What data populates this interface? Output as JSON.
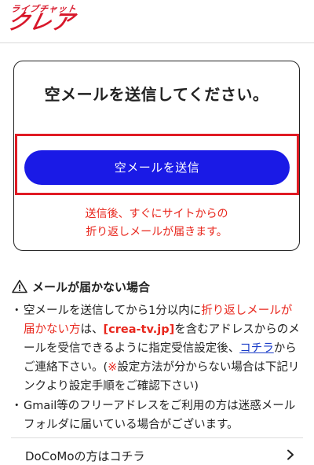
{
  "header": {
    "logo_top": "ライブチャット",
    "logo_main": "クレア"
  },
  "card": {
    "title": "空メールを送信してください。",
    "send_button": "空メールを送信",
    "note_line1": "送信後、すぐにサイトからの",
    "note_line2": "折り返しメールが届きます。"
  },
  "warning": {
    "title": "メールが届かない場合",
    "bullet1": {
      "dot": "・",
      "t1": "空メールを送信してから1分以内に",
      "t2_red": "折り返しメールが届かない方",
      "t3": "は、",
      "t4_red_bold": "[crea-tv.jp]",
      "t5": "を含むアドレスからのメールを受信できるように指定受信設定後、",
      "t6_link": "コチラ",
      "t7": "からご連絡下さい。(",
      "t8_red": "※",
      "t9": "設定方法が分からない場合は下記リンクより設定手順をご確認下さい)"
    },
    "bullet2": {
      "dot": "・",
      "text": "Gmail等のフリーアドレスをご利用の方は迷惑メールフォルダに届いている場合がございます。"
    }
  },
  "links": {
    "docomo": "DoCoMoの方はコチラ"
  },
  "colors": {
    "brand_red": "#d8182b",
    "button_blue": "#1a1ae6",
    "alert_red": "#e8261c",
    "link_blue": "#1a3cc8"
  },
  "icons": {
    "warning": "warning-triangle-icon",
    "chevron": "chevron-right-icon"
  }
}
